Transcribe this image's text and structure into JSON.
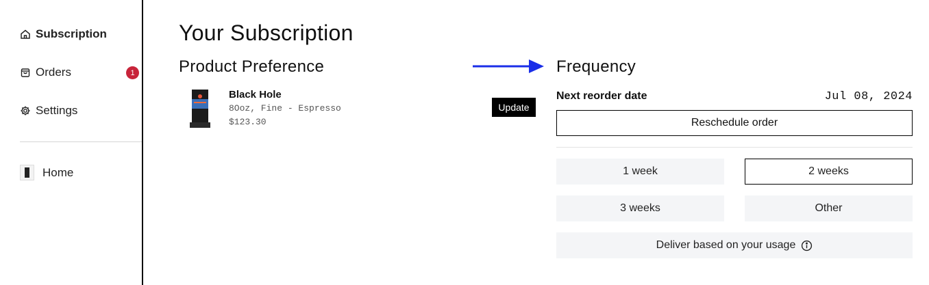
{
  "sidebar": {
    "items": [
      {
        "label": "Subscription",
        "icon": "home-icon",
        "active": true
      },
      {
        "label": "Orders",
        "icon": "shopping-bag-icon",
        "badge": "1"
      },
      {
        "label": "Settings",
        "icon": "gear-icon"
      }
    ],
    "home": {
      "label": "Home",
      "icon": "product-thumbnail"
    }
  },
  "main": {
    "title": "Your Subscription",
    "product_section": {
      "title": "Product Preference",
      "product": {
        "name": "Black Hole",
        "spec": "8Ooz, Fine - Espresso",
        "price": "$123.30"
      },
      "update_label": "Update"
    },
    "frequency_section": {
      "title": "Frequency",
      "next_reorder_label": "Next reorder date",
      "next_reorder_date": "Jul 08, 2024",
      "reschedule_label": "Reschedule order",
      "options": [
        {
          "label": "1 week",
          "selected": false
        },
        {
          "label": "2 weeks",
          "selected": true
        },
        {
          "label": "3 weeks",
          "selected": false
        },
        {
          "label": "Other",
          "selected": false
        }
      ],
      "usage_label": "Deliver based on your usage"
    }
  },
  "colors": {
    "badge": "#c8243a",
    "arrow": "#1a2ee8",
    "option_bg": "#f4f5f7"
  }
}
